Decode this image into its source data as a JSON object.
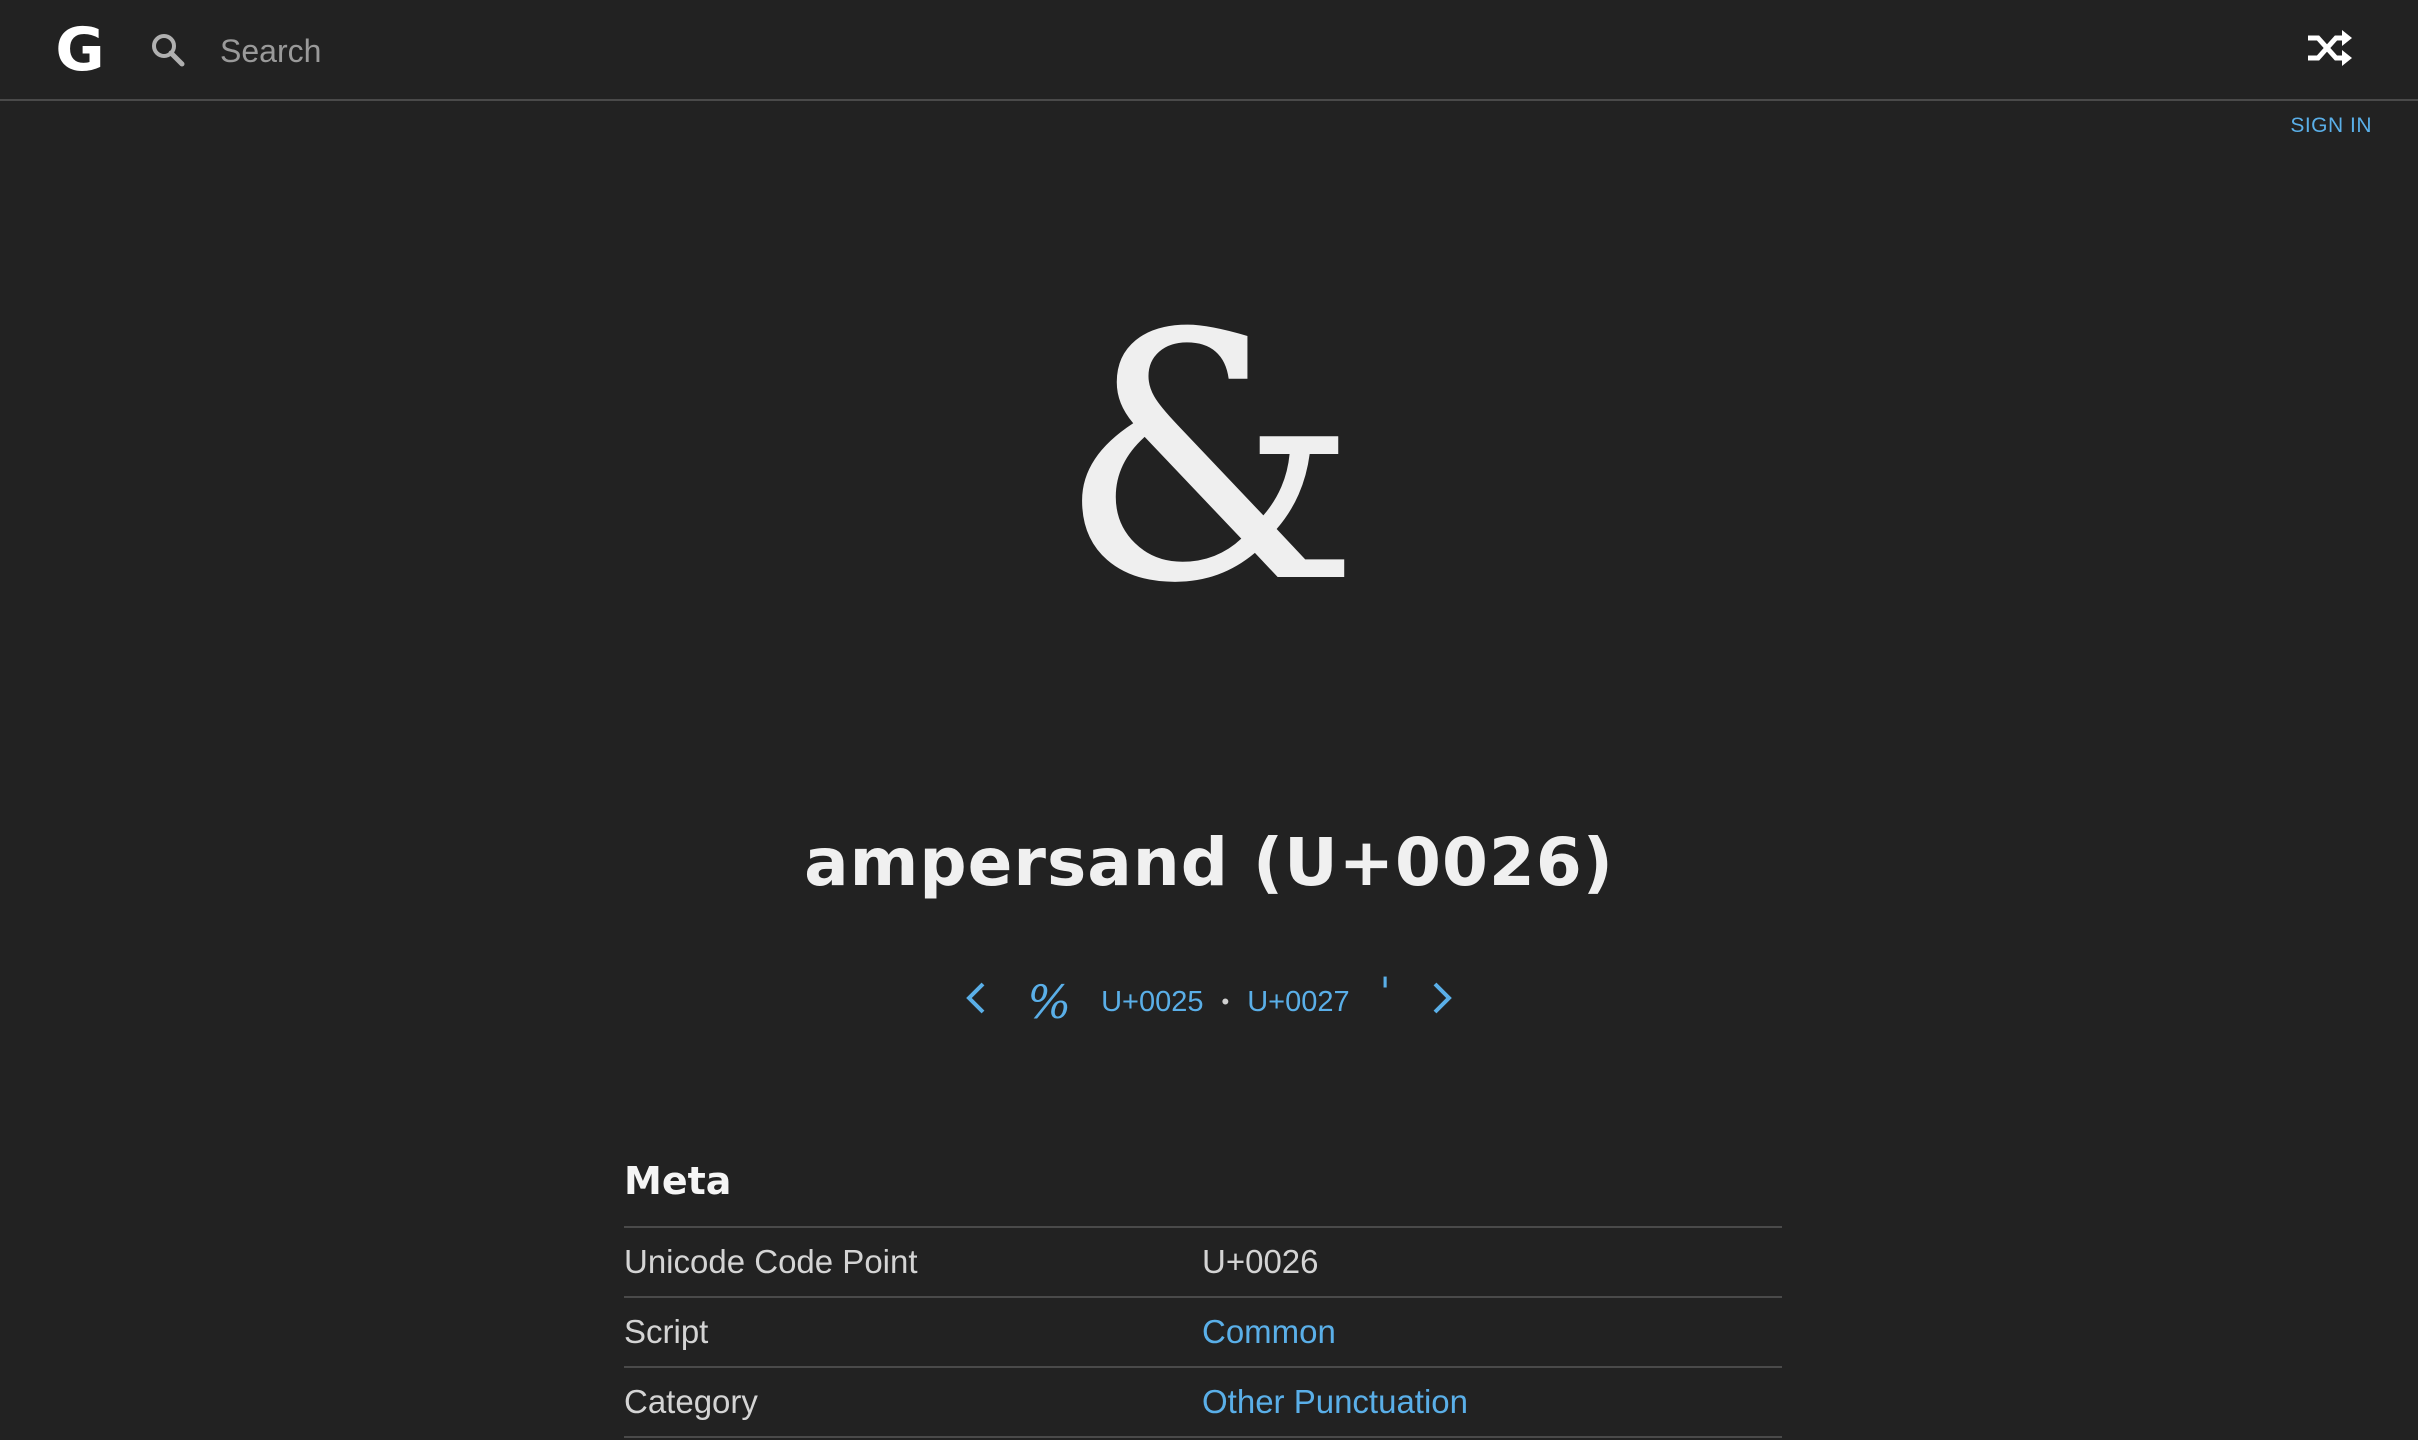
{
  "header": {
    "logo_text": "G",
    "search_placeholder": "Search",
    "search_value": "",
    "icons": [
      "search-icon",
      "shuffle-icon"
    ],
    "sign_in_label": "SIGN IN"
  },
  "character": {
    "glyph": "&",
    "title": "ampersand (U+0026)"
  },
  "navigation": {
    "prev_char": "%",
    "prev_code": "U+0025",
    "separator": "•",
    "next_code": "U+0027",
    "next_char": "'"
  },
  "meta": {
    "heading": "Meta",
    "rows": [
      {
        "label": "Unicode Code Point",
        "value": "U+0026",
        "link": false
      },
      {
        "label": "Script",
        "value": "Common",
        "link": true
      },
      {
        "label": "Category",
        "value": "Other Punctuation",
        "link": true
      }
    ]
  },
  "colors": {
    "background": "#222222",
    "accent": "#5aafe8",
    "text": "#e6e6e6",
    "divider": "#4a4a4a"
  }
}
